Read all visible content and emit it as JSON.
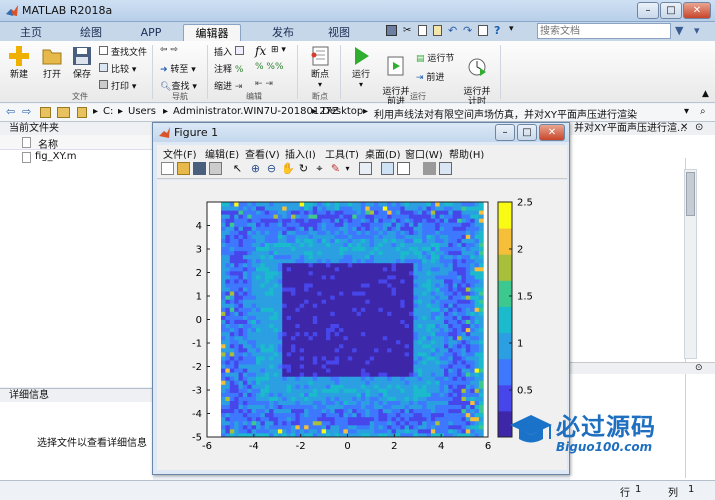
{
  "app": {
    "title": "MATLAB R2018a",
    "search_placeholder": "搜索文档"
  },
  "window_controls": {
    "minimize": "–",
    "maximize": "□",
    "close": "✕"
  },
  "tabs": [
    {
      "label": "主页"
    },
    {
      "label": "绘图"
    },
    {
      "label": "APP"
    },
    {
      "label": "编辑器"
    },
    {
      "label": "发布"
    },
    {
      "label": "视图"
    }
  ],
  "active_tab": "编辑器",
  "ribbon": {
    "file": {
      "new": "新建",
      "open": "打开",
      "save": "保存",
      "find_files": "查找文件",
      "compare": "比较",
      "print": "打印",
      "group": "文件"
    },
    "nav": {
      "goto": "转至",
      "find": "查找",
      "group": "导航"
    },
    "edit": {
      "insert": "插入",
      "comment": "注释",
      "indent": "缩进",
      "fx": "fx",
      "group": "编辑"
    },
    "breakpoints": {
      "label": "断点",
      "group": "断点"
    },
    "run": {
      "run": "运行",
      "run_advance": "运行并\n前进",
      "run_section": "运行节",
      "advance": "前进",
      "run_time": "运行并\n计时",
      "group": "运行"
    }
  },
  "address": {
    "parts": [
      "C:",
      "Users",
      "Administrator.WIN7U-20180127Z",
      "Desktop",
      "利用声线法对有限空间声场仿真，并对XY平面声压进行渲染"
    ],
    "right_overflow": "并对XY平面声压进行渲..."
  },
  "current_folder": {
    "title": "当前文件夹",
    "column": "名称",
    "files": [
      "fig_XY.m"
    ]
  },
  "details": {
    "title": "详细信息",
    "hint": "选择文件以查看详细信息"
  },
  "status": {
    "row_label": "行",
    "row_value": "1",
    "col_label": "列",
    "col_value": "1"
  },
  "watermark": {
    "name": "必过源码",
    "site": "Biguo100.com"
  },
  "figure": {
    "title": "Figure 1",
    "menu": [
      "文件(F)",
      "编辑(E)",
      "查看(V)",
      "插入(I)",
      "工具(T)",
      "桌面(D)",
      "窗口(W)",
      "帮助(H)"
    ]
  },
  "chart_data": {
    "type": "heatmap",
    "title": "",
    "xlabel": "",
    "ylabel": "",
    "x_ticks": [
      -6,
      -4,
      -2,
      0,
      2,
      4,
      6
    ],
    "y_ticks": [
      -5,
      -4,
      -3,
      -2,
      -1,
      0,
      1,
      2,
      3,
      4
    ],
    "xlim": [
      -6,
      6
    ],
    "ylim": [
      -5,
      5
    ],
    "data_extent_x": [
      -5.4,
      5.8
    ],
    "data_extent_y": [
      -5,
      5
    ],
    "colorbar_ticks": [
      0.5,
      1,
      1.5,
      2,
      2.5
    ],
    "colorbar_range": [
      0,
      2.5
    ],
    "colormap": [
      "#3e26a8",
      "#4746eb",
      "#3d78fe",
      "#2b9fe2",
      "#1bbacc",
      "#3dc88f",
      "#a7bf3b",
      "#f6bf3a",
      "#f9fb15"
    ],
    "plot_style": "filled contour (contourf) with black contour lines",
    "background_color": "#352a87"
  }
}
